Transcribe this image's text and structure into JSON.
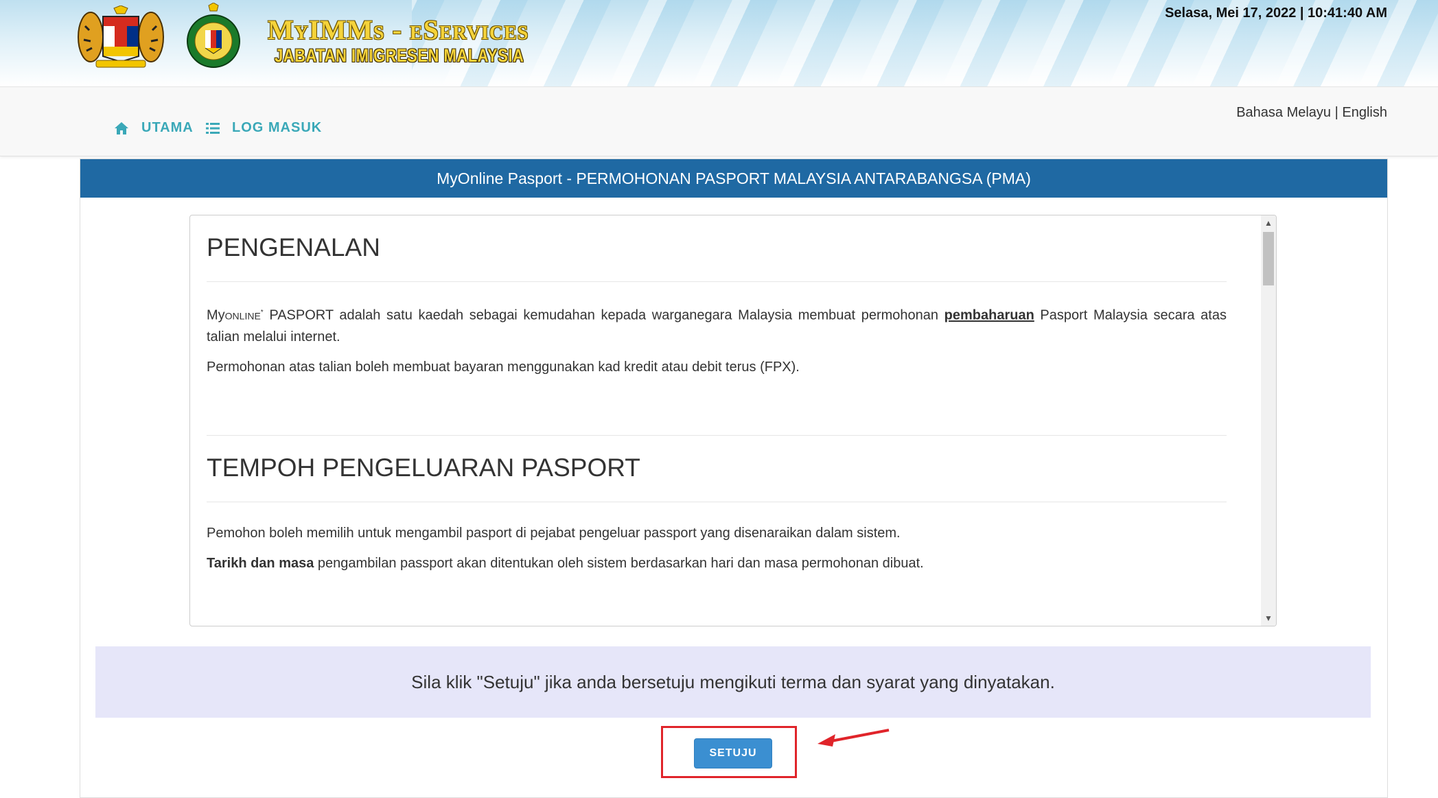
{
  "header": {
    "brand_title": "MyIMMs - eServices",
    "brand_subtitle": "JABATAN IMIGRESEN MALAYSIA",
    "datetime": "Selasa, Mei 17, 2022 | 10:41:40 AM",
    "crest_icon": "malaysia-coat-of-arms-icon",
    "immigration_logo_icon": "immigration-department-logo-icon"
  },
  "nav": {
    "home_label": "UTAMA",
    "login_label": "LOG MASUK",
    "home_icon": "home-icon",
    "login_icon": "list-icon",
    "lang_malay": "Bahasa Melayu",
    "lang_separator": "|",
    "lang_english": "English"
  },
  "card": {
    "header_title": "MyOnline Pasport - PERMOHONAN PASPORT MALAYSIA ANTARABANGSA (PMA)"
  },
  "content": {
    "section1_title": "PENGENALAN",
    "p1_my": "My",
    "p1_online": "ONLINE",
    "p1_star": "*",
    "p1_pasport": " PASPORT",
    "p1_text_a": "  adalah satu kaedah sebagai kemudahan kepada warganegara Malaysia membuat permohonan ",
    "p1_bold": "pembaharuan",
    "p1_text_b": " Pasport Malaysia secara atas talian melalui internet.",
    "p2": "Permohonan atas talian boleh membuat bayaran menggunakan kad kredit atau debit terus (FPX).",
    "section2_title": "TEMPOH PENGELUARAN PASPORT",
    "p3": "Pemohon boleh memilih untuk mengambil pasport di pejabat pengeluar passport yang disenaraikan dalam sistem.",
    "p4_bold": "Tarikh dan masa",
    "p4_text": " pengambilan passport akan ditentukan oleh sistem berdasarkan hari dan masa permohonan dibuat."
  },
  "agreement": {
    "text": "Sila klik \"Setuju\" jika anda bersetuju mengikuti terma dan syarat yang dinyatakan.",
    "button_label": "SETUJU"
  },
  "colors": {
    "header_blue": "#1f69a3",
    "nav_teal": "#3aa8b8",
    "button_blue": "#3b8fd1",
    "highlight_red": "#e0242a",
    "agree_bg": "#e6e6f9"
  }
}
